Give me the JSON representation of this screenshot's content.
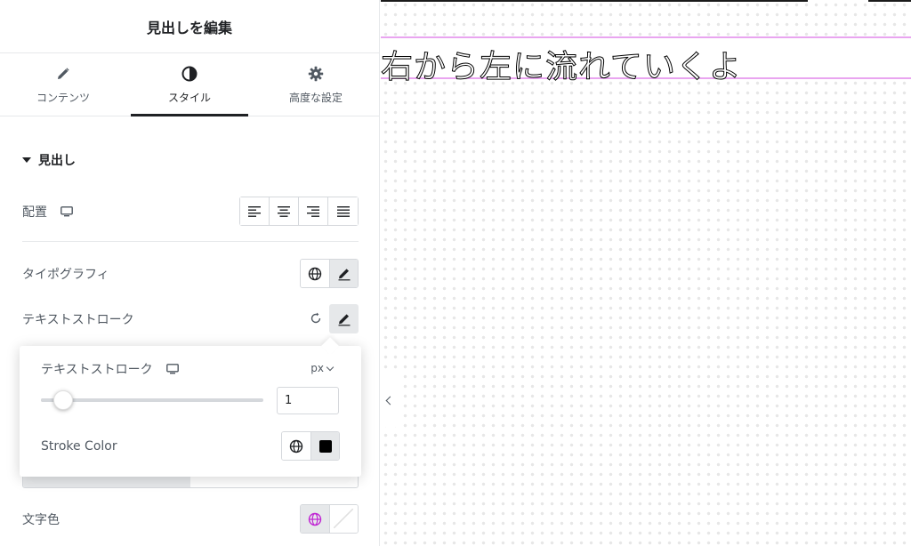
{
  "panel": {
    "title": "見出しを編集",
    "tabs": [
      {
        "label": "コンテンツ",
        "icon": "pencil-icon"
      },
      {
        "label": "スタイル",
        "icon": "half-circle-icon",
        "active": true
      },
      {
        "label": "高度な設定",
        "icon": "gear-icon"
      }
    ],
    "section_title": "見出し",
    "alignment_label": "配置",
    "typography_label": "タイポグラフィ",
    "text_stroke_label": "テキストストローク",
    "text_color_label": "文字色"
  },
  "popover": {
    "title": "テキストストローク",
    "unit": "px",
    "slider_fraction": 0.1,
    "value": "1",
    "stroke_color_label": "Stroke Color",
    "stroke_color": "#000000"
  },
  "canvas": {
    "heading": "右から左に流れていくよ"
  },
  "colors": {
    "accent_pink": "#e9a5f0",
    "globe_magenta": "#c026d3"
  }
}
